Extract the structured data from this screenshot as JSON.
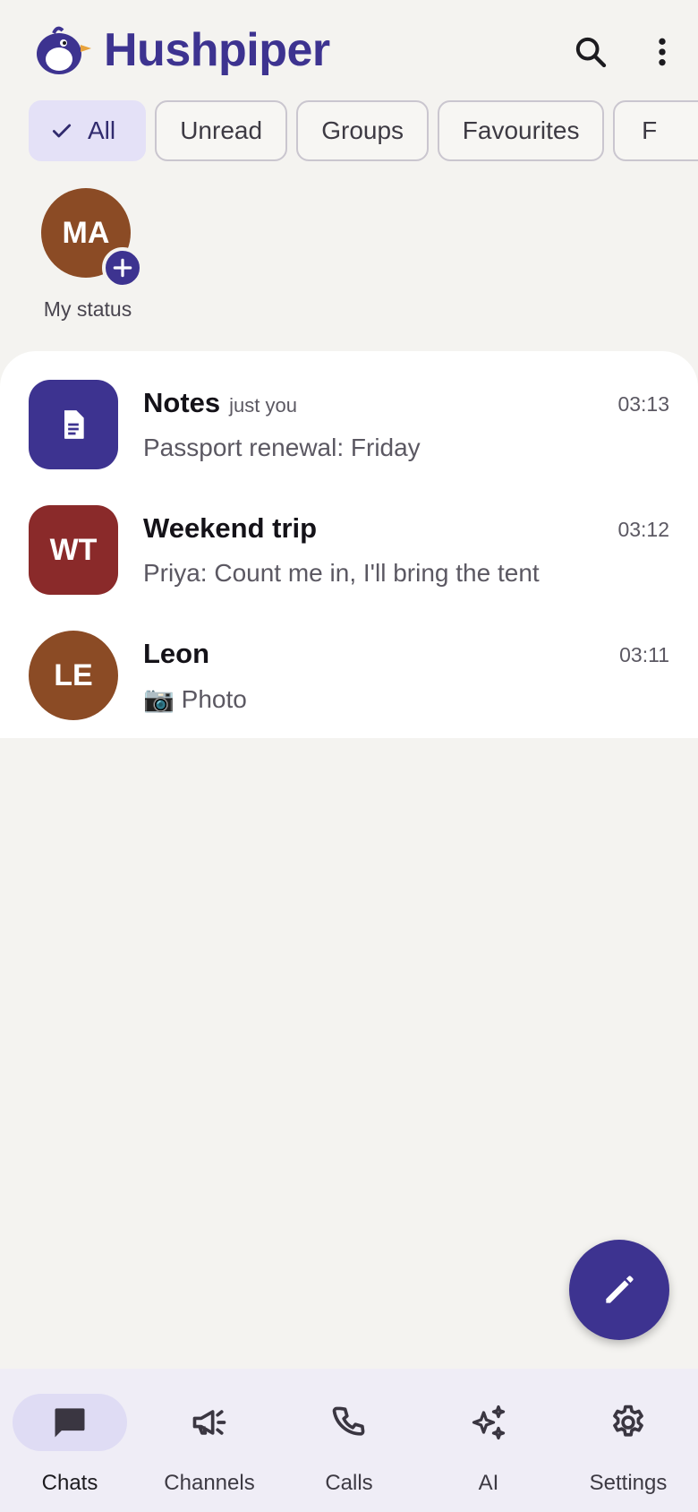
{
  "app": {
    "title": "Hushpiper"
  },
  "colors": {
    "brand": "#3d3390",
    "chip_active_bg": "#e4e1f7",
    "background": "#f4f3f0"
  },
  "header": {
    "search_icon": "search-icon",
    "more_icon": "more-vert-icon"
  },
  "filters": {
    "chips": [
      {
        "label": "All",
        "selected": true
      },
      {
        "label": "Unread",
        "selected": false
      },
      {
        "label": "Groups",
        "selected": false
      },
      {
        "label": "Favourites",
        "selected": false
      },
      {
        "label": "F",
        "selected": false
      }
    ]
  },
  "status": {
    "initials": "MA",
    "label": "My status",
    "add_icon": "plus-icon"
  },
  "chats": [
    {
      "name": "Notes",
      "sub": "just you",
      "time": "03:13",
      "preview": "Passport renewal: Friday",
      "avatar_icon": "document-icon",
      "avatar_color": "#3d3390"
    },
    {
      "name": "Weekend trip",
      "sub": "",
      "time": "03:12",
      "preview": "Priya: Count me in, I'll bring the tent",
      "initials": "WT",
      "avatar_color": "#8a2a2a"
    },
    {
      "name": "Leon",
      "sub": "",
      "time": "03:11",
      "preview": "📷 Photo",
      "initials": "LE",
      "avatar_color": "#8b4b25"
    }
  ],
  "fab": {
    "icon": "pencil-icon"
  },
  "nav": {
    "items": [
      {
        "label": "Chats",
        "icon": "chat-icon",
        "active": true
      },
      {
        "label": "Channels",
        "icon": "megaphone-icon",
        "active": false
      },
      {
        "label": "Calls",
        "icon": "phone-icon",
        "active": false
      },
      {
        "label": "AI",
        "icon": "sparkles-icon",
        "active": false
      },
      {
        "label": "Settings",
        "icon": "gear-icon",
        "active": false
      }
    ]
  }
}
